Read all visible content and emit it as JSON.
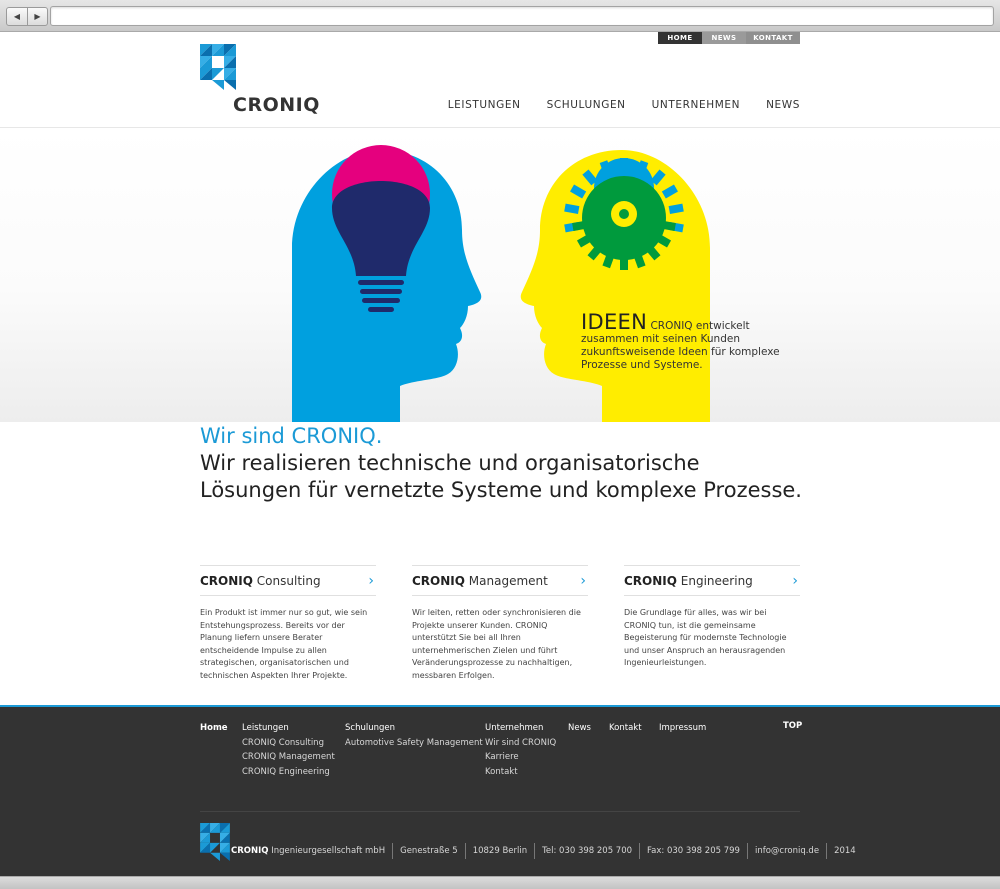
{
  "browser": {
    "back_icon": "triangle-left-icon",
    "forward_icon": "triangle-right-icon",
    "back_glyph": "◀",
    "forward_glyph": "▶",
    "address": ""
  },
  "brand": {
    "name": "CRONIQ",
    "colors": {
      "blue": "#1b9ad6",
      "cyan": "#00a0df",
      "yellow": "#ffed00",
      "magenta": "#e5007e",
      "green": "#009a3d",
      "navy": "#1f2a6b",
      "dark": "#333333"
    }
  },
  "topnav": {
    "home": "HOME",
    "news": "NEWS",
    "kontakt": "KONTAKT"
  },
  "mainnav": [
    "LEISTUNGEN",
    "SCHULUNGEN",
    "UNTERNEHMEN",
    "NEWS"
  ],
  "hero": {
    "title": "IDEEN",
    "text": "CRONIQ entwickelt zusammen mit seinen Kunden zukunftsweisende Ideen für komplexe Prozesse und Systeme."
  },
  "intro": {
    "headline": "Wir sind CRONIQ.",
    "line1": "Wir realisieren technische und organisatorische",
    "line2": "Lösungen für vernetzte Systeme und komplexe Prozesse."
  },
  "services": [
    {
      "brand": "CRONIQ",
      "name": "Consulting",
      "chevron": "›",
      "text": "Ein Produkt ist immer nur so gut, wie sein Entstehungsprozess. Bereits vor der Planung liefern unsere Berater entscheidende Impulse zu allen strategischen, organisatorischen und technischen Aspekten Ihrer Projekte."
    },
    {
      "brand": "CRONIQ",
      "name": "Management",
      "chevron": "›",
      "text": "Wir leiten, retten oder synchronisieren die Projekte unserer Kunden. CRONIQ unterstützt Sie bei all Ihren unternehmerischen Zielen und führt Veränderungsprozesse zu nachhaltigen, messbaren Erfolgen."
    },
    {
      "brand": "CRONIQ",
      "name": "Engineering",
      "chevron": "›",
      "text": "Die Grundlage für alles, was wir bei CRONIQ tun, ist die gemeinsame Begeisterung für modernste Technologie und unser Anspruch an herausragenden Ingenieurleistungen."
    }
  ],
  "footer": {
    "home": "Home",
    "leistungen": {
      "label": "Leistungen",
      "items": [
        "CRONIQ Consulting",
        "CRONIQ Management",
        "CRONIQ Engineering"
      ]
    },
    "schulungen": {
      "label": "Schulungen",
      "items": [
        "Automotive Safety Management"
      ]
    },
    "unternehmen": {
      "label": "Unternehmen",
      "items": [
        "Wir sind CRONIQ",
        "Karriere",
        "Kontakt"
      ]
    },
    "news": "News",
    "kontakt": "Kontakt",
    "impressum": "Impressum",
    "top": "TOP",
    "company_brand": "CRONIQ",
    "company_rest": "Ingenieurgesellschaft mbH",
    "street": "Genestraße 5",
    "city": "10829 Berlin",
    "tel": "Tel: 030 398 205 700",
    "fax": "Fax: 030 398 205 799",
    "email": "info@croniq.de",
    "year": "2014"
  }
}
